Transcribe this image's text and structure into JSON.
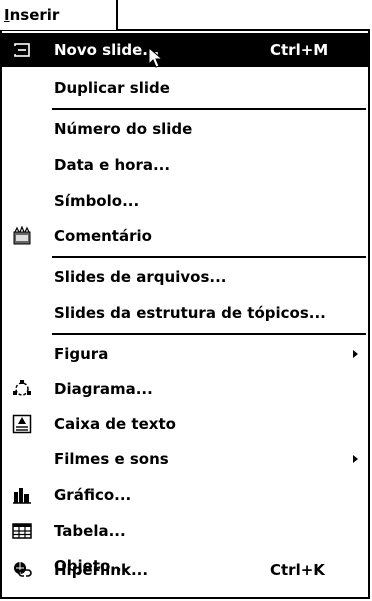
{
  "menu": {
    "title": "Inserir",
    "items": [
      {
        "label": "Novo slide...",
        "shortcut": "Ctrl+M"
      },
      {
        "label": "Duplicar slide"
      },
      {
        "label": "Número do slide"
      },
      {
        "label": "Data e hora..."
      },
      {
        "label": "Símbolo..."
      },
      {
        "label": "Comentário"
      },
      {
        "label": "Slides de arquivos..."
      },
      {
        "label": "Slides da estrutura de tópicos..."
      },
      {
        "label": "Figura"
      },
      {
        "label": "Diagrama..."
      },
      {
        "label": "Caixa de texto"
      },
      {
        "label": "Filmes e sons"
      },
      {
        "label": "Gráfico..."
      },
      {
        "label": "Tabela..."
      },
      {
        "label": "Objeto..."
      },
      {
        "label": "Hiperlink...",
        "shortcut": "Ctrl+K"
      }
    ]
  },
  "icons": {
    "novo_slide": "new-slide-icon",
    "comentario": "comment-icon",
    "diagrama": "diagram-icon",
    "caixa_texto": "text-box-icon",
    "grafico": "chart-icon",
    "tabela": "table-icon",
    "hiperlink": "hyperlink-icon",
    "cursor": "mouse-pointer-icon"
  },
  "colors": {
    "highlight": "#000000",
    "background": "#ffffff"
  }
}
